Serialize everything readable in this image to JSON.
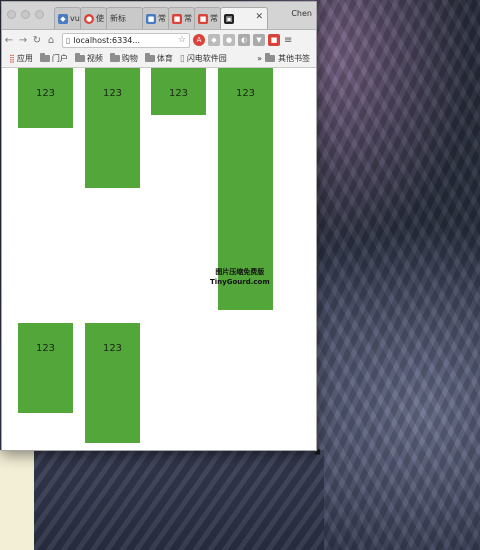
{
  "window": {
    "profile_name": "Chen",
    "tabs": [
      {
        "label": "vu",
        "icon": "vue-icon",
        "color": "#4a7cc2"
      },
      {
        "label": "使",
        "icon": "stop-icon",
        "color": "#d9433a"
      },
      {
        "label": "新标",
        "icon": "",
        "color": ""
      },
      {
        "label": "常",
        "icon": "site-icon",
        "color": "#4a7cc2"
      },
      {
        "label": "常",
        "icon": "site-icon",
        "color": "#d9433a"
      },
      {
        "label": "常",
        "icon": "site-icon",
        "color": "#d9433a"
      },
      {
        "label": "",
        "icon": "image-icon",
        "color": "#222222",
        "active": true
      }
    ],
    "url": "localhost:6334...",
    "bookmarks": {
      "apps": "应用",
      "items": [
        "门户",
        "视频",
        "购物",
        "体育"
      ],
      "page_item": "闪电软件园",
      "more": "»",
      "other": "其他书签"
    }
  },
  "content": {
    "boxes": [
      "123",
      "123",
      "123",
      "123",
      "123",
      "123"
    ],
    "watermark_line1": "图片压缩免费版",
    "watermark_line2": "TinyGourd.com"
  },
  "colors": {
    "box_green": "#53a63a"
  }
}
